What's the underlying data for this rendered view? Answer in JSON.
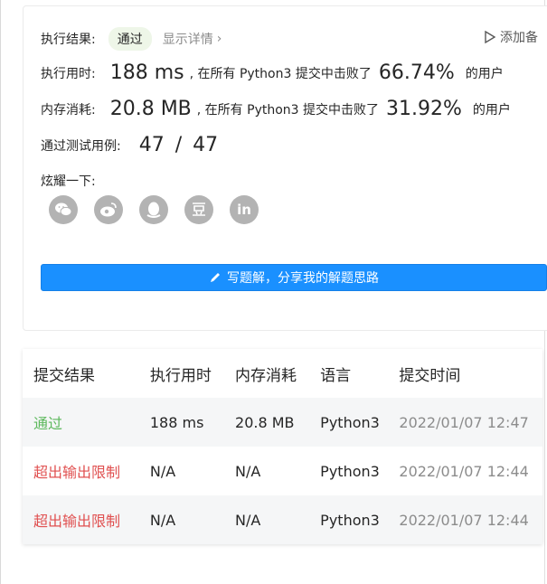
{
  "result": {
    "label": "执行结果:",
    "status": "通过",
    "details_link": "显示详情",
    "add_note": "添加备"
  },
  "runtime": {
    "label": "执行用时:",
    "value": "188 ms",
    "text": ", 在所有 Python3 提交中击败了",
    "percent": "66.74%",
    "suffix": "的用户"
  },
  "memory": {
    "label": "内存消耗:",
    "value": "20.8 MB",
    "text": ", 在所有 Python3 提交中击败了",
    "percent": "31.92%",
    "suffix": "的用户"
  },
  "testcases": {
    "label": "通过测试用例:",
    "passed": "47",
    "sep": "/",
    "total": "47"
  },
  "share": {
    "label": "炫耀一下:",
    "icons": [
      "wechat-icon",
      "weibo-icon",
      "qq-icon",
      "douban-icon",
      "linkedin-icon"
    ]
  },
  "write_solution": {
    "label": "写题解，分享我的解题思路"
  },
  "submissions": {
    "headers": [
      "提交结果",
      "执行用时",
      "内存消耗",
      "语言",
      "提交时间"
    ],
    "rows": [
      {
        "result": "通过",
        "runtime": "188 ms",
        "memory": "20.8 MB",
        "lang": "Python3",
        "time": "2022/01/07 12:47"
      },
      {
        "result": "超出输出限制",
        "runtime": "N/A",
        "memory": "N/A",
        "lang": "Python3",
        "time": "2022/01/07 12:44"
      },
      {
        "result": "超出输出限制",
        "runtime": "N/A",
        "memory": "N/A",
        "lang": "Python3",
        "time": "2022/01/07 12:44"
      }
    ]
  },
  "colors": {
    "accent": "#1a90ff",
    "success": "#5cb85c",
    "error": "#e05050"
  }
}
